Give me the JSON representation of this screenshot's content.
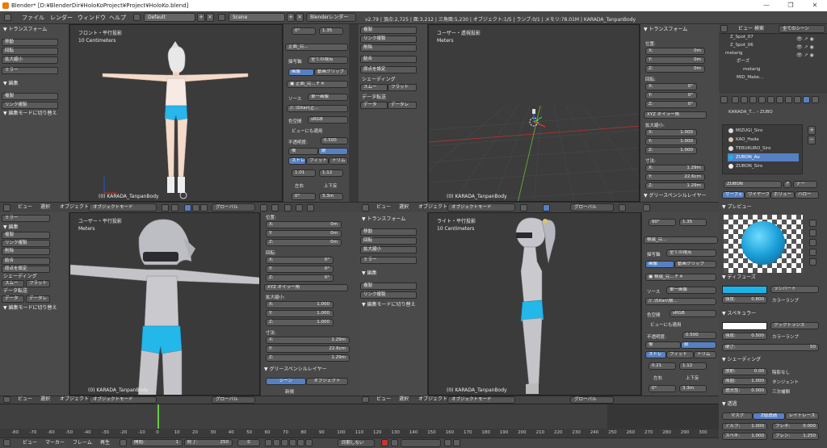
{
  "window": {
    "title": "Blender* [D:¥BlenderDir¥HoloKoProject¥Project¥HoloKo.blend]",
    "min": "—",
    "max": "❐",
    "close": "✕"
  },
  "menubar": {
    "items": [
      "ファイル",
      "レンダー",
      "ウィンドウ",
      "ヘルプ"
    ],
    "screen": "Default",
    "scene": "Scene",
    "engine": "Blenderレンダー",
    "info": "v2.79 | 頂点:2,725 | 面:3,212 | 三角面:5,230 | オブジェクト:1/5 | ランプ:0/1 | メモリ:78.01M | KARADA_TanpanBody"
  },
  "viewports": {
    "front": {
      "label": "フロント・平行投影",
      "sub": "10 Centimeters",
      "object": "(0) KARADA_TanpanBody"
    },
    "user_persp": {
      "label": "ユーザー・透視投影",
      "sub": "Meters",
      "object": "(0) KARADA_TanpanBody"
    },
    "user": {
      "label": "ユーザー・平行投影",
      "sub": "Meters",
      "object": "(0) KARADA_TanpanBody"
    },
    "right": {
      "label": "ライト・平行投影",
      "sub": "10 Centimeters",
      "object": "(0) KARADA_TanpanBody"
    }
  },
  "toolshelf": {
    "transform": "▼ トランスフォーム",
    "move": "移動",
    "rotate": "回転",
    "scale": "拡大縮小",
    "mirror": "ミラー",
    "edit": "▼ 編集",
    "duplicate": "複製",
    "link_dup": "リンク複製",
    "delete": "削除",
    "join": "結合",
    "origin": "原点を設定",
    "shading": "シェーディング",
    "smooth": "スムー",
    "flat": "フラット",
    "data_transfer": "データ転送",
    "data": "データ",
    "data2": "データレ",
    "editmode": "▼ 編集モードに切り替え"
  },
  "imagepanel": {
    "name": "正面_完...",
    "view": "全ての視点",
    "axis": "描写軸",
    "tab_image": "画像",
    "tab_movie": "動画クリップ",
    "source_label": "ソース",
    "source": "単一画像",
    "path": "//..\\Sitan\\正...",
    "colorspace_label": "色空間",
    "colorspace": "sRGB",
    "use_view": "ビューにも適用",
    "opacity_label": "不透明度:",
    "opacity": "0.500",
    "back": "後",
    "front": "前",
    "stretch": "ストレ",
    "fit": "フィット",
    "crop": "トリム",
    "rot": "0°",
    "size": "1.35",
    "x": "1.01",
    "y": "1.12",
    "lr": "左右",
    "ud": "上下反",
    "off": "0°",
    "dist": "3.3m"
  },
  "imagepanel_r": {
    "name": "横還_完...",
    "view": "全ての視点",
    "axis": "描写軸",
    "tab_image": "画像",
    "tab_movie": "動画クリップ",
    "source_label": "ソース",
    "source": "単一画像",
    "path": "//..\\Sitan\\横...",
    "colorspace_label": "色空間",
    "colorspace": "sRGB",
    "use_view": "ビューにも適用",
    "opacity_label": "不透明度:",
    "opacity": "0.500",
    "back": "後",
    "front": "前",
    "stretch": "ストレ",
    "fit": "フィット",
    "crop": "トリム",
    "rot": "90°",
    "size": "1.35",
    "x": "0.21",
    "y": "1.12",
    "lr": "左右",
    "ud": "上下反",
    "off": "0°",
    "dist": "3.3m"
  },
  "transform": {
    "title": "▼ トランスフォーム",
    "location": "位置:",
    "lx": "X:",
    "lxv": "0m",
    "ly": "Y:",
    "lyv": "0m",
    "lz": "Z:",
    "lzv": "0m",
    "rotation": "回転:",
    "rx": "X:",
    "rxv": "0°",
    "ry": "Y:",
    "ryv": "0°",
    "rz": "Z:",
    "rzv": "0°",
    "mode": "XYZ オイラー角",
    "scale": "拡大縮小:",
    "sx": "X:",
    "sxv": "1.000",
    "sy": "Y:",
    "syv": "1.000",
    "sz": "Z:",
    "szv": "1.000",
    "dims": "寸法:",
    "dx": "X:",
    "dxv": "1.29m",
    "dy": "Y:",
    "dyv": "22.6cm",
    "dz": "Z:",
    "dzv": "1.29m",
    "grease": "▼ グリースペンシルレイヤー",
    "scene": "シーン",
    "object": "オブジェクト",
    "new": "新規"
  },
  "viewheader": {
    "view": "ビュー",
    "select": "選択",
    "object": "オブジェクト",
    "mode": "オブジェクトモード",
    "global": "グローバル"
  },
  "outliner": {
    "view": "ビュー",
    "search": "検索",
    "scenes": "全てのシーン",
    "rows": [
      "Z_Spot_07",
      "Z_Spot_06",
      "metarig",
      "ポーズ",
      "metarig",
      "MID_Make..."
    ]
  },
  "material": {
    "object": "KARADA_T...",
    "arrow": "›",
    "ob": "ZUBO",
    "slots": [
      "MIZUGI_Siro",
      "KAO_Hada",
      "TEBUKURO_Siro",
      "ZUBON_Ao",
      "ZUBON_Siro"
    ],
    "name": "ZUBON",
    "f": "F",
    "data": "デー",
    "tabs": [
      "サーフェ",
      "ワイヤーフ",
      "ボリュー",
      "ハロー"
    ],
    "preview": "▼ プレビュー",
    "diffuse": "▼ ディフューズ",
    "lambert": "ランバート",
    "intensity": "強度:",
    "intensity_v": "0.800",
    "ramp": "カラーランプ",
    "specular": "▼ スペキュラー",
    "cooktorr": "クックトランス",
    "spec_int": "強度:",
    "spec_int_v": "0.500",
    "spec_ramp": "カラーランプ",
    "hardness": "硬さ:",
    "hardness_v": "50",
    "shading": "▼ シェーディング",
    "emit": "放射:",
    "emit_v": "0.00",
    "shadeless": "陰影なし",
    "ambient": "周囲:",
    "ambient_v": "1.000",
    "tangent": "タンジェント",
    "transl": "透光性:",
    "transl_v": "0.000",
    "cubic": "三次補間",
    "transparency": "▼ 透過",
    "mask": "マスク",
    "ztrans": "Z値透過",
    "raytrace": "レイトレース",
    "alpha": "アルフ:",
    "alpha_v": "1.000",
    "fresnel": "フレネ:",
    "fresnel_v": "0.000",
    "spec": "スペキ:",
    "spec_v": "1.000",
    "blend": "ブレン:",
    "blend_v": "1.250",
    "colors": {
      "diffuse": "#1ab4e8",
      "specular": "#ffffff",
      "ball": "#1a9fd8"
    }
  },
  "timeline": {
    "ticks": [
      "-80",
      "-70",
      "-60",
      "-50",
      "-40",
      "-30",
      "-20",
      "-10",
      "0",
      "10",
      "20",
      "30",
      "40",
      "50",
      "60",
      "70",
      "80",
      "90",
      "100",
      "110",
      "120",
      "130",
      "140",
      "150",
      "160",
      "170",
      "180",
      "190",
      "200",
      "210",
      "220",
      "230",
      "240",
      "250",
      "260",
      "270",
      "280",
      "290",
      "300"
    ],
    "view": "ビュー",
    "marker": "マーカー",
    "frame": "フレーム",
    "playback": "再生",
    "start_label": "開始:",
    "start": "1",
    "end_label": "終了:",
    "end": "250",
    "current": "0",
    "sync": "同期しない"
  }
}
